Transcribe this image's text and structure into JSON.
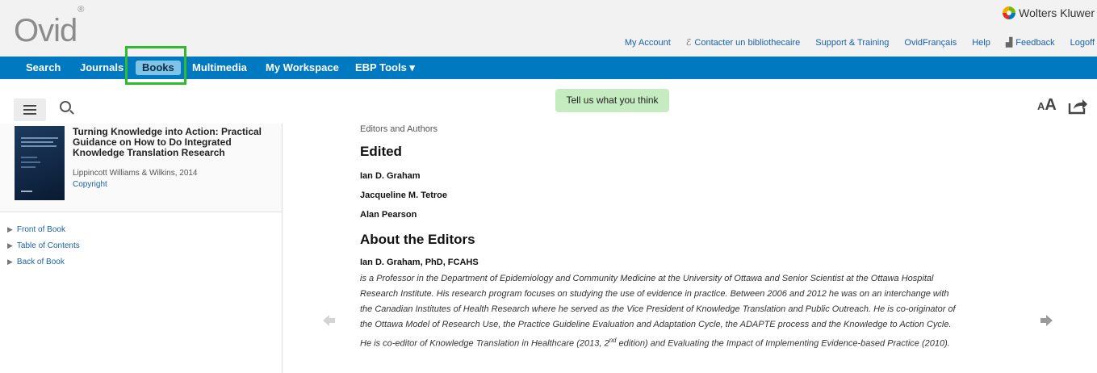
{
  "header": {
    "logo": "Ovid",
    "logo_mark": "®",
    "brand": "Wolters Kluwer",
    "links": {
      "my_account": "My Account",
      "librarian": "Contacter un bibliothecaire",
      "support": "Support & Training",
      "ovid_francais": "OvidFrançais",
      "help": "Help",
      "feedback": "Feedback",
      "logoff": "Logoff"
    }
  },
  "nav": {
    "search": "Search",
    "journals": "Journals",
    "books": "Books",
    "multimedia": "Multimedia",
    "workspace": "My Workspace",
    "ebp_tools": "EBP Tools ▾"
  },
  "toolbar": {
    "feedback_pill": "Tell us what you think",
    "text_size_small": "A",
    "text_size_large": "A"
  },
  "book": {
    "title": "Turning Knowledge into Action: Practical Guidance on How to Do Integrated Knowledge Translation Research",
    "publisher": "Lippincott Williams & Wilkins, 2014",
    "copyright": "Copyright"
  },
  "toc": {
    "items": [
      "Front of Book",
      "Table of Contents",
      "Back of Book"
    ]
  },
  "content": {
    "breadcrumb": "Editors and Authors",
    "edited_heading": "Edited",
    "editors": [
      "Ian D. Graham",
      "Jacqueline M. Tetroe",
      "Alan Pearson"
    ],
    "about_heading": "About the Editors",
    "bio_name": "Ian D. Graham, PhD, FCAHS",
    "bio_lines": [
      "is a Professor in the Department of Epidemiology and Community Medicine at the University of Ottawa and Senior Scientist at the Ottawa Hospital",
      "Research Institute. His research program focuses on studying the use of evidence in practice. Between 2006 and 2012 he was on an interchange with",
      "the Canadian Institutes of Health Research where he served as the Vice President of Knowledge Translation and Public Outreach. He is co-originator of",
      "the Ottawa Model of Research Use, the Practice Guideline Evaluation and Adaptation Cycle, the ADAPTE process and the Knowledge to Action Cycle."
    ],
    "bio_last_pre": "He is co-editor of Knowledge Translation in Healthcare (2013, 2",
    "bio_last_sup": "nd",
    "bio_last_post": " edition) and Evaluating the Impact of Implementing Evidence-based Practice (2010)."
  },
  "colors": {
    "nav_bg": "#0079c1",
    "nav_active": "#7fc4e6",
    "link": "#1a62a8",
    "highlight": "#2ebc2e",
    "pill": "#c5ecc0"
  }
}
